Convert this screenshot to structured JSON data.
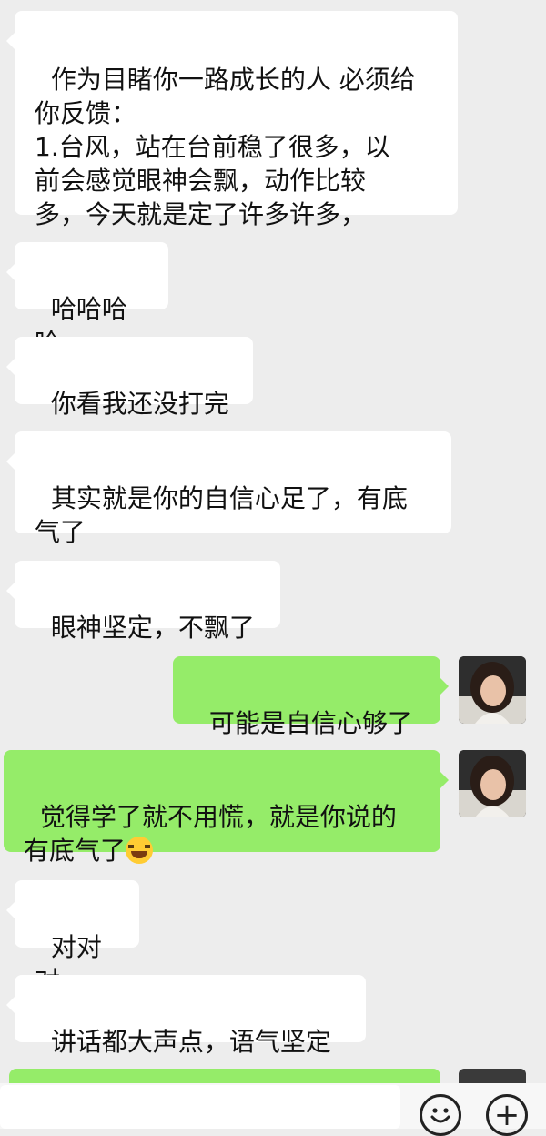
{
  "messages": [
    {
      "side": "left",
      "text": "作为目睹你一路成长的人 必须给\n你反馈：\n1.台风，站在台前稳了很多，以\n前会感觉眼神会飘，动作比较\n多，今天就是定了许多许多，"
    },
    {
      "side": "left",
      "text": "哈哈哈哈"
    },
    {
      "side": "left",
      "text": "你看我还没打完"
    },
    {
      "side": "left",
      "text": "其实就是你的自信心足了，有底\n气了"
    },
    {
      "side": "left",
      "text": "眼神坚定，不飘了"
    },
    {
      "side": "right",
      "text": "可能是自信心够了"
    },
    {
      "side": "right",
      "text": "觉得学了就不用慌，就是你说的\n有底气了",
      "emoji": "laughing-tears-emoji"
    },
    {
      "side": "left",
      "text": "对对对"
    },
    {
      "side": "left",
      "text": "讲话都大声点，语气坚定"
    }
  ],
  "toolbar": {
    "emoji_button_icon": "smiley-icon",
    "plus_button_icon": "plus-icon",
    "plus_glyph": "+"
  },
  "colors": {
    "background": "#ededed",
    "incoming_bubble": "#ffffff",
    "outgoing_bubble": "#95ec69"
  }
}
